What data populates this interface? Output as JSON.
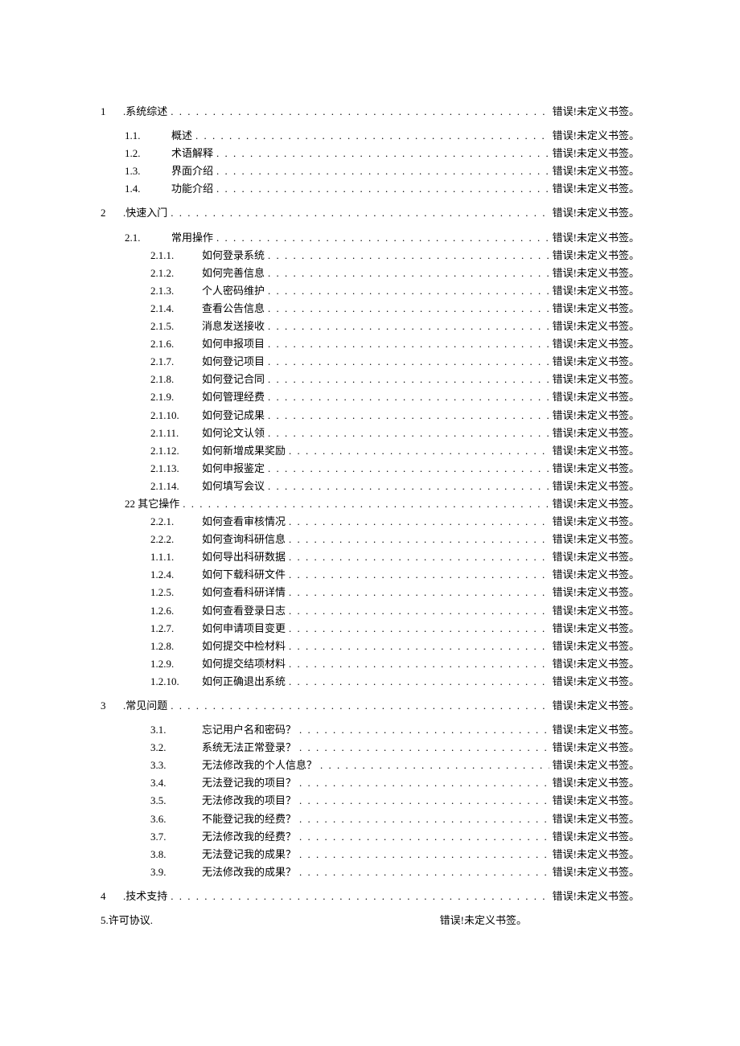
{
  "error_text": "错误!未定义书签。",
  "entries": [
    {
      "level": 1,
      "num": "1",
      "title": ".系统综述"
    },
    {
      "level": 2,
      "num": "1.1.",
      "title": "概述"
    },
    {
      "level": 2,
      "num": "1.2.",
      "title": "术语解释"
    },
    {
      "level": 2,
      "num": "1.3.",
      "title": "界面介绍"
    },
    {
      "level": 2,
      "num": "1.4.",
      "title": "功能介绍"
    },
    {
      "level": 1,
      "num": "2",
      "title": ".快速入门"
    },
    {
      "level": 2,
      "num": "2.1.",
      "title": "常用操作"
    },
    {
      "level": 3,
      "num": "2.1.1.",
      "title": "如何登录系统"
    },
    {
      "level": 3,
      "num": "2.1.2.",
      "title": "如何完善信息"
    },
    {
      "level": 3,
      "num": "2.1.3.",
      "title": "个人密码维护"
    },
    {
      "level": 3,
      "num": "2.1.4.",
      "title": "查看公告信息"
    },
    {
      "level": 3,
      "num": "2.1.5.",
      "title": "消息发送接收"
    },
    {
      "level": 3,
      "num": "2.1.6.",
      "title": "如何申报项目"
    },
    {
      "level": 3,
      "num": "2.1.7.",
      "title": "如何登记项目"
    },
    {
      "level": 3,
      "num": "2.1.8.",
      "title": "如何登记合同"
    },
    {
      "level": 3,
      "num": "2.1.9.",
      "title": "如何管理经费"
    },
    {
      "level": 3,
      "num": "2.1.10.",
      "title": "如何登记成果"
    },
    {
      "level": 3,
      "num": "2.1.11.",
      "title": "如何论文认领"
    },
    {
      "level": 3,
      "num": "2.1.12.",
      "title": "如何新增成果奖励"
    },
    {
      "level": 3,
      "num": "2.1.13.",
      "title": "如何申报鉴定"
    },
    {
      "level": 3,
      "num": "2.1.14.",
      "title": "如何填写会议"
    },
    {
      "level": "2alt",
      "num": "",
      "title": "22 其它操作"
    },
    {
      "level": 3,
      "num": "2.2.1.",
      "title": "如何查看审核情况"
    },
    {
      "level": 3,
      "num": "2.2.2.",
      "title": "如何查询科研信息"
    },
    {
      "level": 3,
      "num": "1.1.1.",
      "title": "如何导出科研数据"
    },
    {
      "level": 3,
      "num": "1.2.4.",
      "title": "如何下载科研文件"
    },
    {
      "level": 3,
      "num": "1.2.5.",
      "title": "如何查看科研详情"
    },
    {
      "level": 3,
      "num": "1.2.6.",
      "title": "如何查看登录日志"
    },
    {
      "level": 3,
      "num": "1.2.7.",
      "title": "如何申请项目变更"
    },
    {
      "level": 3,
      "num": "1.2.8.",
      "title": "如何提交中检材料"
    },
    {
      "level": 3,
      "num": "1.2.9.",
      "title": "如何提交结项材料"
    },
    {
      "level": 3,
      "num": "1.2.10.",
      "title": "如何正确退出系统"
    },
    {
      "level": 1,
      "num": "3",
      "title": ".常见问题"
    },
    {
      "level": 3,
      "num": "3.1.",
      "title": "忘记用户名和密码？"
    },
    {
      "level": 3,
      "num": "3.2.",
      "title": "系统无法正常登录？"
    },
    {
      "level": 3,
      "num": "3.3.",
      "title": "无法修改我的个人信息？"
    },
    {
      "level": 3,
      "num": "3.4.",
      "title": "无法登记我的项目？"
    },
    {
      "level": 3,
      "num": "3.5.",
      "title": "无法修改我的项目？"
    },
    {
      "level": 3,
      "num": "3.6.",
      "title": "不能登记我的经费？"
    },
    {
      "level": 3,
      "num": "3.7.",
      "title": "无法修改我的经费？"
    },
    {
      "level": 3,
      "num": "3.8.",
      "title": "无法登记我的成果？"
    },
    {
      "level": 3,
      "num": "3.9.",
      "title": "无法修改我的成果？"
    },
    {
      "level": 1,
      "num": "4",
      "title": ".技术支持"
    }
  ],
  "special": {
    "left": "5.许可协议.",
    "right": "错误!未定义书签。"
  }
}
